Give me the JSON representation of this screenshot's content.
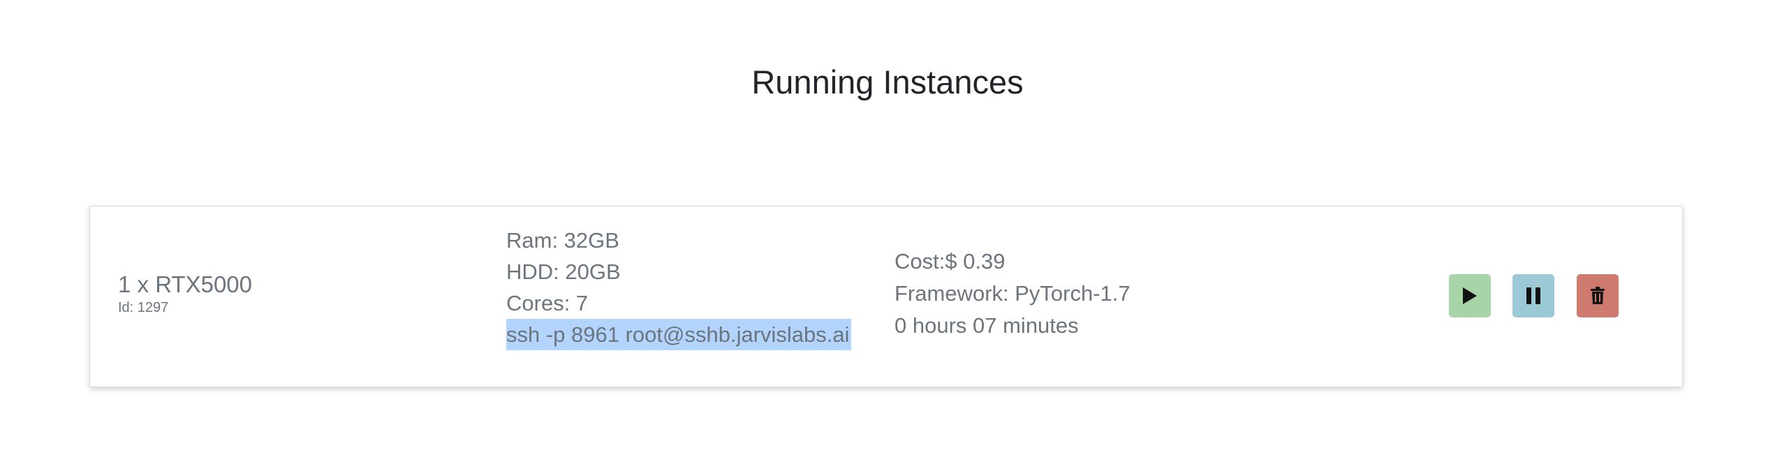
{
  "page": {
    "title": "Running Instances"
  },
  "instance": {
    "gpu": "1 x RTX5000",
    "id_label": "Id: 1297",
    "ram": "Ram: 32GB",
    "hdd": "HDD: 20GB",
    "cores": "Cores: 7",
    "ssh": "ssh -p 8961 root@sshb.jarvislabs.ai",
    "cost": "Cost:$ 0.39",
    "framework": "Framework: PyTorch-1.7",
    "uptime": "0 hours 07 minutes"
  },
  "actions": {
    "start_icon": "play-icon",
    "pause_icon": "pause-icon",
    "delete_icon": "trash-icon"
  },
  "colors": {
    "start": "#a8d5a8",
    "pause": "#9cc9d6",
    "delete": "#cf7a6f",
    "ssh_highlight": "#b3d4fc"
  }
}
